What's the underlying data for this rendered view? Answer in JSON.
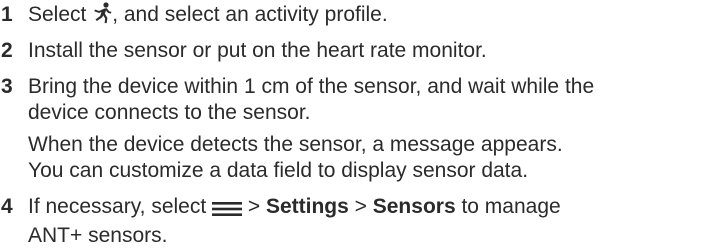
{
  "steps": [
    {
      "number": "1",
      "text_a": "Select ",
      "icon": "running-person-icon",
      "text_b": ", and select an activity profile."
    },
    {
      "number": "2",
      "text": "Install the sensor or put on the heart rate monitor."
    },
    {
      "number": "3",
      "line1": "Bring the device within 1 cm of the sensor, and wait while the",
      "line2": "device connects to the sensor.",
      "note_line1": "When the device detects the sensor, a message appears.",
      "note_line2": "You can customize a data field to display sensor data."
    },
    {
      "number": "4",
      "text_a": "If necessary, select ",
      "icon": "menu-icon",
      "text_b": " > ",
      "settings": "Settings",
      "text_c": " > ",
      "sensors": "Sensors",
      "text_d": " to manage",
      "line2": "ANT+ sensors."
    }
  ]
}
